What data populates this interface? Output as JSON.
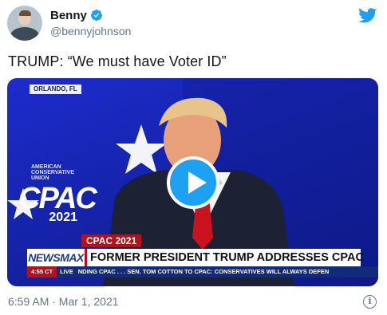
{
  "author": {
    "display_name": "Benny",
    "handle": "@bennyjohnson",
    "verified": true,
    "avatar_icon": "profile-photo"
  },
  "brand_icon": "twitter-bird-icon",
  "brand_color": "#1da1f2",
  "tweet": {
    "text": "TRUMP: “We must have Voter ID”",
    "timestamp": "6:59 AM · Mar 1, 2021"
  },
  "video": {
    "dateline": "ORLANDO, FL",
    "stage_logo": {
      "org_line1": "AMERICAN",
      "org_line2": "CONSERVATIVE",
      "org_line3": "UNION",
      "word": "CPAC",
      "year": "2021"
    },
    "lower_third": {
      "tag": "CPAC 2021",
      "network": "NEWSMAX",
      "headline": "FORMER PRESIDENT TRUMP ADDRESSES CPAC",
      "time": "4:55 CT",
      "live": "LIVE",
      "crawl": "NDING CPAC . . .     SEN. TOM COTTON TO CPAC: CONSERVATIVES WILL ALWAYS DEFEN"
    },
    "play_icon": "play-icon"
  },
  "info_icon": "info-icon"
}
